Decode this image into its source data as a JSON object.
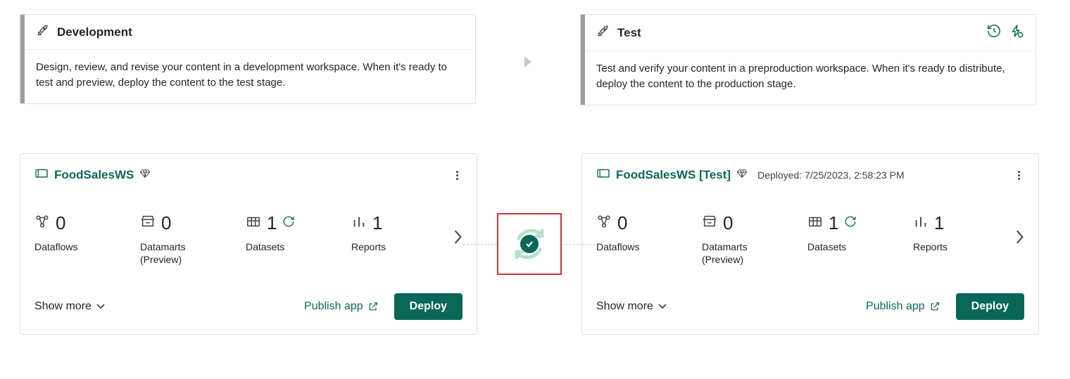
{
  "stages": {
    "dev": {
      "title": "Development",
      "desc": "Design, review, and revise your content in a development workspace. When it's ready to test and preview, deploy the content to the test stage."
    },
    "test": {
      "title": "Test",
      "desc": "Test and verify your content in a preproduction workspace. When it's ready to distribute, deploy the content to the production stage."
    }
  },
  "workspaces": {
    "dev": {
      "name": "FoodSalesWS",
      "stats": {
        "dataflows": {
          "value": "0",
          "label": "Dataflows"
        },
        "datamarts": {
          "value": "0",
          "label": "Datamarts",
          "sublabel": "(Preview)"
        },
        "datasets": {
          "value": "1",
          "label": "Datasets"
        },
        "reports": {
          "value": "1",
          "label": "Reports"
        }
      },
      "showMore": "Show more",
      "publish": "Publish app",
      "deploy": "Deploy"
    },
    "test": {
      "name": "FoodSalesWS [Test]",
      "deployedLabel": "Deployed: 7/25/2023, 2:58:23 PM",
      "stats": {
        "dataflows": {
          "value": "0",
          "label": "Dataflows"
        },
        "datamarts": {
          "value": "0",
          "label": "Datamarts",
          "sublabel": "(Preview)"
        },
        "datasets": {
          "value": "1",
          "label": "Datasets"
        },
        "reports": {
          "value": "1",
          "label": "Reports"
        }
      },
      "showMore": "Show more",
      "publish": "Publish app",
      "deploy": "Deploy"
    }
  },
  "syncStatus": "in-sync"
}
